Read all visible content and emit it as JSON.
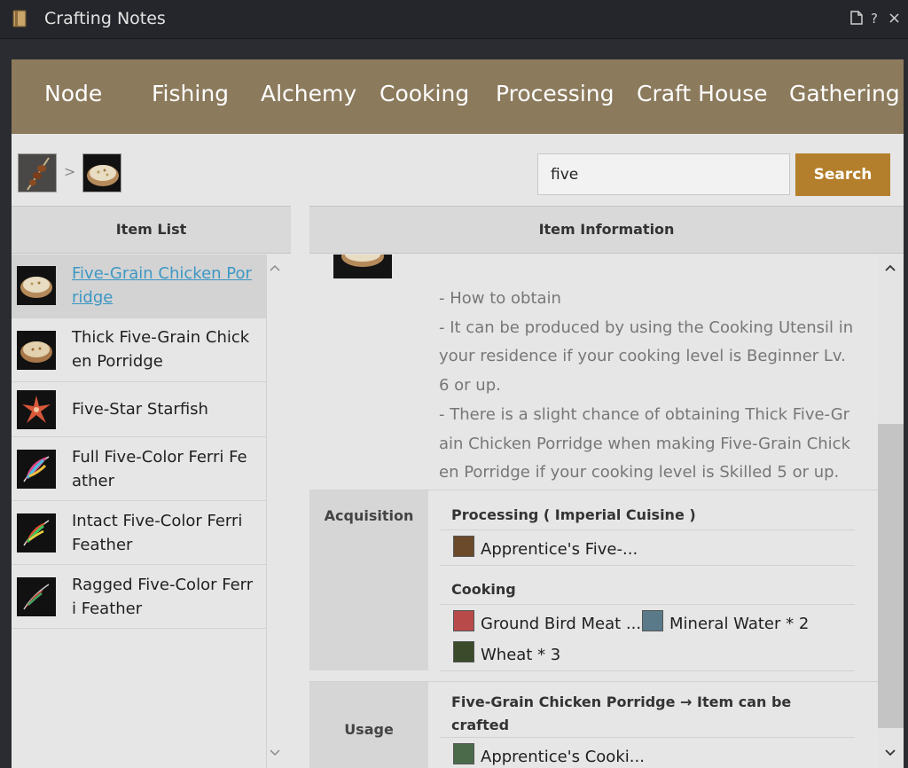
{
  "window": {
    "title": "Crafting Notes",
    "icon": "book-icon",
    "controls": [
      "page-icon",
      "?",
      "×"
    ]
  },
  "tabs": [
    "Node",
    "Fishing",
    "Alchemy",
    "Cooking",
    "Processing",
    "Craft House",
    "Gathering"
  ],
  "breadcrumb": {
    "separator": ">"
  },
  "search": {
    "value": "five",
    "button_label": "Search"
  },
  "item_list": {
    "header": "Item List",
    "items": [
      {
        "label": "Five-Grain Chicken Porridge",
        "icon": "porridge-icon",
        "selected": true
      },
      {
        "label": "Thick Five-Grain Chicken Porridge",
        "icon": "porridge-icon",
        "selected": false
      },
      {
        "label": "Five-Star Starfish",
        "icon": "starfish-icon",
        "selected": false
      },
      {
        "label": "Full Five-Color Ferri Feather",
        "icon": "feather-icon",
        "selected": false
      },
      {
        "label": "Intact Five-Color Ferri Feather",
        "icon": "feather-icon",
        "selected": false
      },
      {
        "label": "Ragged Five-Color Ferri Feather",
        "icon": "feather-icon",
        "selected": false
      }
    ]
  },
  "item_info": {
    "header": "Item Information",
    "description": [
      "- How to obtain",
      "- It can be produced by using the Cooking Utensil in your residence if your cooking level is Beginner Lv.6 or up.",
      "- There is a slight chance of obtaining Thick Five-Grain Chicken Porridge when making Five-Grain Chicken Porridge if your cooking level is Skilled 5 or up."
    ],
    "acquisition": {
      "label": "Acquisition",
      "processing_title": "Processing ( Imperial Cuisine )",
      "processing_item": "Apprentice's Five-...",
      "cooking_title": "Cooking",
      "materials": [
        "Ground Bird Meat ...",
        "Mineral Water * 2",
        "Wheat * 3"
      ]
    },
    "usage": {
      "label": "Usage",
      "title": "Five-Grain Chicken Porridge → Item can be crafted",
      "item": "Apprentice's Cooki..."
    }
  },
  "colors": {
    "tabbar": "#8b7a5c",
    "search_button": "#b47f2c",
    "selected_link": "#3d97c4"
  }
}
